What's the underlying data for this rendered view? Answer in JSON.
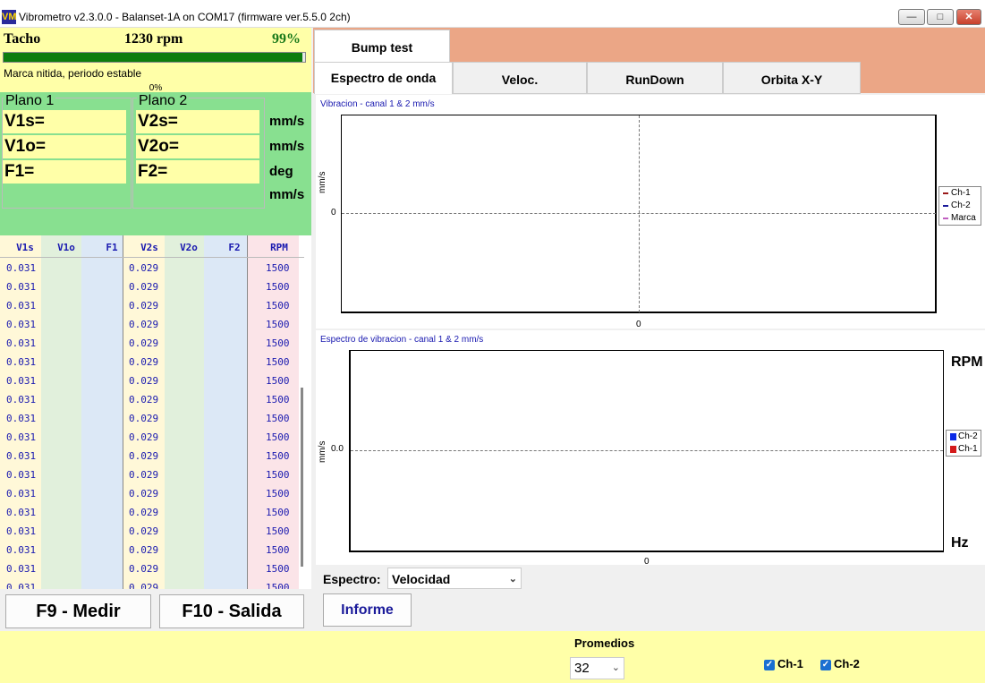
{
  "window": {
    "title": "Vibrometro v2.3.0.0 - Balanset-1A on COM17 (firmware ver.5.5.0 2ch)",
    "icon_text": "VM"
  },
  "tacho": {
    "label": "Tacho",
    "rpm": "1230 rpm",
    "percent": "99%",
    "progress": 0.99,
    "status": "Marca nitida, periodo estable",
    "bar2_percent": "0%"
  },
  "planes": {
    "plane1": {
      "title": "Plano 1",
      "v_s": "V1s=",
      "v_o": "V1o=",
      "f": "F1="
    },
    "plane2": {
      "title": "Plano 2",
      "v_s": "V2s=",
      "v_o": "V2o=",
      "f": "F2="
    },
    "units": [
      "mm/s",
      "mm/s",
      "deg",
      "mm/s"
    ]
  },
  "table": {
    "headers": [
      "V1s",
      "V1o",
      "F1",
      "V2s",
      "V2o",
      "F2",
      "RPM"
    ],
    "rows": [
      [
        "0.031",
        "",
        "",
        "0.029",
        "",
        "",
        "1500"
      ],
      [
        "0.031",
        "",
        "",
        "0.029",
        "",
        "",
        "1500"
      ],
      [
        "0.031",
        "",
        "",
        "0.029",
        "",
        "",
        "1500"
      ],
      [
        "0.031",
        "",
        "",
        "0.029",
        "",
        "",
        "1500"
      ],
      [
        "0.031",
        "",
        "",
        "0.029",
        "",
        "",
        "1500"
      ],
      [
        "0.031",
        "",
        "",
        "0.029",
        "",
        "",
        "1500"
      ],
      [
        "0.031",
        "",
        "",
        "0.029",
        "",
        "",
        "1500"
      ],
      [
        "0.031",
        "",
        "",
        "0.029",
        "",
        "",
        "1500"
      ],
      [
        "0.031",
        "",
        "",
        "0.029",
        "",
        "",
        "1500"
      ],
      [
        "0.031",
        "",
        "",
        "0.029",
        "",
        "",
        "1500"
      ],
      [
        "0.031",
        "",
        "",
        "0.029",
        "",
        "",
        "1500"
      ],
      [
        "0.031",
        "",
        "",
        "0.029",
        "",
        "",
        "1500"
      ],
      [
        "0.031",
        "",
        "",
        "0.029",
        "",
        "",
        "1500"
      ],
      [
        "0.031",
        "",
        "",
        "0.029",
        "",
        "",
        "1500"
      ],
      [
        "0.031",
        "",
        "",
        "0.029",
        "",
        "",
        "1500"
      ],
      [
        "0.031",
        "",
        "",
        "0.029",
        "",
        "",
        "1500"
      ],
      [
        "0.031",
        "",
        "",
        "0.029",
        "",
        "",
        "1500"
      ],
      [
        "0.031",
        "",
        "",
        "0.029",
        "",
        "",
        "1500"
      ],
      [
        "0.031",
        "",
        "",
        "0.029",
        "",
        "",
        "1500"
      ]
    ]
  },
  "buttons": {
    "measure": "F9 - Medir",
    "exit": "F10 - Salida",
    "report": "Informe"
  },
  "tabs": {
    "bump": "Bump test",
    "row": [
      "Espectro de onda",
      "Veloc.",
      "RunDown",
      "Orbita X-Y"
    ],
    "active": "Espectro de onda"
  },
  "chart1": {
    "title": "Vibracion  - canal 1 & 2 mm/s",
    "ylabel": "mm/s",
    "y_tick": "0",
    "x_tick": "0",
    "legend": [
      "Ch-1",
      "Ch-2",
      "Marca"
    ],
    "legend_colors": [
      "#9a1a1a",
      "#1a1a9a",
      "#c060c0"
    ]
  },
  "chart2": {
    "title": "Espectro de vibracion  - canal 1 & 2 mm/s",
    "ylabel": "mm/s",
    "y_tick": "0.0",
    "x_tick": "0",
    "rpm_label": "RPM",
    "hz_label": "Hz",
    "legend": [
      "Ch-2",
      "Ch-1"
    ],
    "legend_colors": [
      "#0a2ae6",
      "#d41a1a"
    ]
  },
  "spectrum": {
    "label": "Espectro:",
    "value": "Velocidad"
  },
  "bottom": {
    "averages_label": "Promedios",
    "averages_value": "32",
    "ch1_label": "Ch-1",
    "ch2_label": "Ch-2",
    "ch1_checked": true,
    "ch2_checked": true
  }
}
